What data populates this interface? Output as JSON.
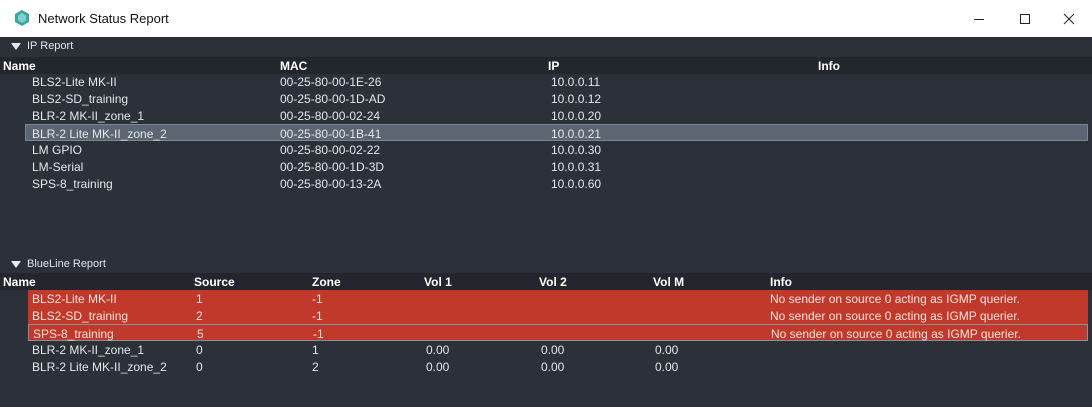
{
  "window": {
    "title": "Network Status Report",
    "colors": {
      "titlebar": "#ffffff",
      "content": "#2c3038",
      "header_row": "#23262c",
      "selection": "#5c6574",
      "error": "#c0392b"
    }
  },
  "ip_report": {
    "label": "IP Report",
    "columns": [
      "Name",
      "MAC",
      "IP",
      "Info"
    ],
    "rows": [
      {
        "name": "BLS2-Lite MK-II",
        "mac": "00-25-80-00-1E-26",
        "ip": "10.0.0.11",
        "info": ""
      },
      {
        "name": "BLS2-SD_training",
        "mac": "00-25-80-00-1D-AD",
        "ip": "10.0.0.12",
        "info": ""
      },
      {
        "name": "BLR-2 MK-II_zone_1",
        "mac": "00-25-80-00-02-24",
        "ip": "10.0.0.20",
        "info": ""
      },
      {
        "name": "BLR-2 Lite MK-II_zone_2",
        "mac": "00-25-80-00-1B-41",
        "ip": "10.0.0.21",
        "info": ""
      },
      {
        "name": "LM GPIO",
        "mac": "00-25-80-00-02-22",
        "ip": "10.0.0.30",
        "info": ""
      },
      {
        "name": "LM-Serial",
        "mac": "00-25-80-00-1D-3D",
        "ip": "10.0.0.31",
        "info": ""
      },
      {
        "name": "SPS-8_training",
        "mac": "00-25-80-00-13-2A",
        "ip": "10.0.0.60",
        "info": ""
      }
    ]
  },
  "blueline_report": {
    "label": "BlueLine Report",
    "columns": [
      "Name",
      "Source",
      "Zone",
      "Vol 1",
      "Vol 2",
      "Vol M",
      "Info"
    ],
    "rows": [
      {
        "name": "BLS2-Lite MK-II",
        "source": "1",
        "zone": "-1",
        "vol1": "",
        "vol2": "",
        "volm": "",
        "info": "No sender on source 0 acting as IGMP querier."
      },
      {
        "name": "BLS2-SD_training",
        "source": "2",
        "zone": "-1",
        "vol1": "",
        "vol2": "",
        "volm": "",
        "info": "No sender on source 0 acting as IGMP querier."
      },
      {
        "name": "SPS-8_training",
        "source": "5",
        "zone": "-1",
        "vol1": "",
        "vol2": "",
        "volm": "",
        "info": "No sender on source 0 acting as IGMP querier."
      },
      {
        "name": "BLR-2 MK-II_zone_1",
        "source": "0",
        "zone": "1",
        "vol1": "0.00",
        "vol2": "0.00",
        "volm": "0.00",
        "info": ""
      },
      {
        "name": "BLR-2 Lite MK-II_zone_2",
        "source": "0",
        "zone": "2",
        "vol1": "0.00",
        "vol2": "0.00",
        "volm": "0.00",
        "info": ""
      }
    ]
  }
}
